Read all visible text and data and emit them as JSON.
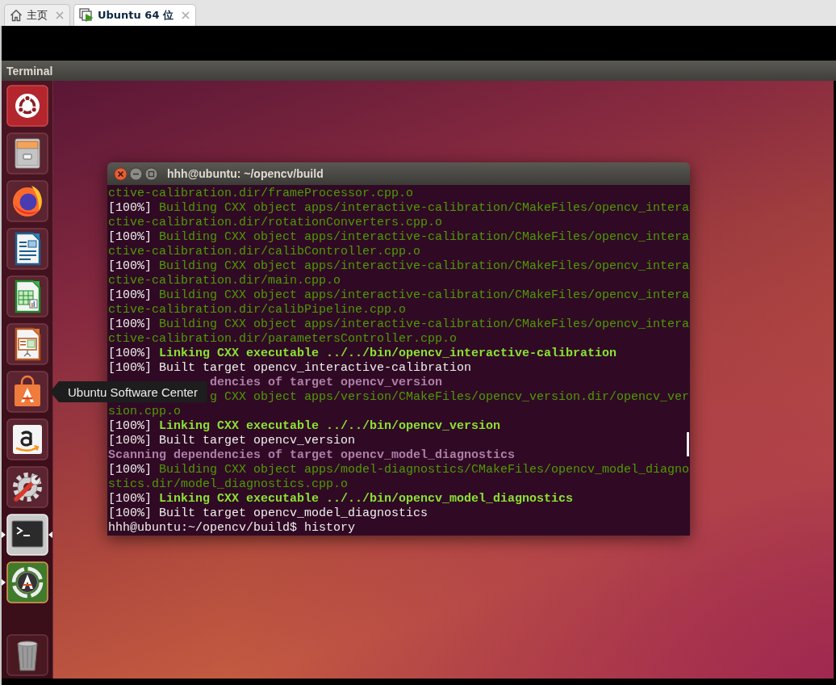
{
  "tabs": [
    {
      "kind": "home",
      "label": "主页",
      "selected": false
    },
    {
      "kind": "vm",
      "label": "Ubuntu 64 位",
      "selected": true
    }
  ],
  "top_panel": {
    "title": "Terminal"
  },
  "launcher": {
    "items": [
      {
        "kind": "dash",
        "running": false,
        "focused": false
      },
      {
        "kind": "files",
        "running": false,
        "focused": false
      },
      {
        "kind": "browser",
        "running": false,
        "focused": false
      },
      {
        "kind": "writer",
        "running": false,
        "focused": false
      },
      {
        "kind": "calc",
        "running": false,
        "focused": false
      },
      {
        "kind": "impress",
        "running": false,
        "focused": false
      },
      {
        "kind": "software",
        "running": false,
        "focused": false,
        "tooltip": "Ubuntu Software Center"
      },
      {
        "kind": "amazon",
        "running": false,
        "focused": false
      },
      {
        "kind": "settings",
        "running": false,
        "focused": false
      },
      {
        "kind": "terminal",
        "running": true,
        "focused": true
      },
      {
        "kind": "updater",
        "running": true,
        "focused": false
      },
      {
        "kind": "trash",
        "running": false,
        "focused": false
      }
    ]
  },
  "terminal": {
    "title": "hhh@ubuntu: ~/opencv/build",
    "lines": [
      {
        "kind": "continuation",
        "text": "ctive-calibration.dir/frameProcessor.cpp.o"
      },
      {
        "kind": "building",
        "prefix": "[100%]",
        "text": "Building CXX object apps/interactive-calibration/CMakeFiles/opencv_intera"
      },
      {
        "kind": "continuation",
        "text": "ctive-calibration.dir/rotationConverters.cpp.o"
      },
      {
        "kind": "building",
        "prefix": "[100%]",
        "text": "Building CXX object apps/interactive-calibration/CMakeFiles/opencv_intera"
      },
      {
        "kind": "continuation",
        "text": "ctive-calibration.dir/calibController.cpp.o"
      },
      {
        "kind": "building",
        "prefix": "[100%]",
        "text": "Building CXX object apps/interactive-calibration/CMakeFiles/opencv_intera"
      },
      {
        "kind": "continuation",
        "text": "ctive-calibration.dir/main.cpp.o"
      },
      {
        "kind": "building",
        "prefix": "[100%]",
        "text": "Building CXX object apps/interactive-calibration/CMakeFiles/opencv_intera"
      },
      {
        "kind": "continuation",
        "text": "ctive-calibration.dir/calibPipeline.cpp.o"
      },
      {
        "kind": "building",
        "prefix": "[100%]",
        "text": "Building CXX object apps/interactive-calibration/CMakeFiles/opencv_intera"
      },
      {
        "kind": "continuation",
        "text": "ctive-calibration.dir/parametersController.cpp.o"
      },
      {
        "kind": "linking",
        "prefix": "[100%]",
        "text": "Linking CXX executable ../../bin/opencv_interactive-calibration"
      },
      {
        "kind": "built",
        "prefix": "[100%]",
        "text": "Built target opencv_interactive-calibration"
      },
      {
        "kind": "scanning",
        "text": "dencies of target opencv_version",
        "covered": true
      },
      {
        "kind": "building",
        "text": "g CXX object apps/version/CMakeFiles/opencv_version.dir/opencv_ver",
        "covered": true
      },
      {
        "kind": "continuation",
        "text": "sion.cpp.o"
      },
      {
        "kind": "linking",
        "prefix": "[100%]",
        "text": "Linking CXX executable ../../bin/opencv_version"
      },
      {
        "kind": "built",
        "prefix": "[100%]",
        "text": "Built target opencv_version"
      },
      {
        "kind": "scanning",
        "text": "Scanning dependencies of target opencv_model_diagnostics"
      },
      {
        "kind": "building",
        "prefix": "[100%]",
        "text": "Building CXX object apps/model-diagnostics/CMakeFiles/opencv_model_diagno"
      },
      {
        "kind": "continuation",
        "text": "stics.dir/model_diagnostics.cpp.o"
      },
      {
        "kind": "linking",
        "prefix": "[100%]",
        "text": "Linking CXX executable ../../bin/opencv_model_diagnostics"
      },
      {
        "kind": "built",
        "prefix": "[100%]",
        "text": "Built target opencv_model_diagnostics"
      },
      {
        "kind": "prompt",
        "text": "hhh@ubuntu:~/opencv/build$ history"
      }
    ]
  }
}
